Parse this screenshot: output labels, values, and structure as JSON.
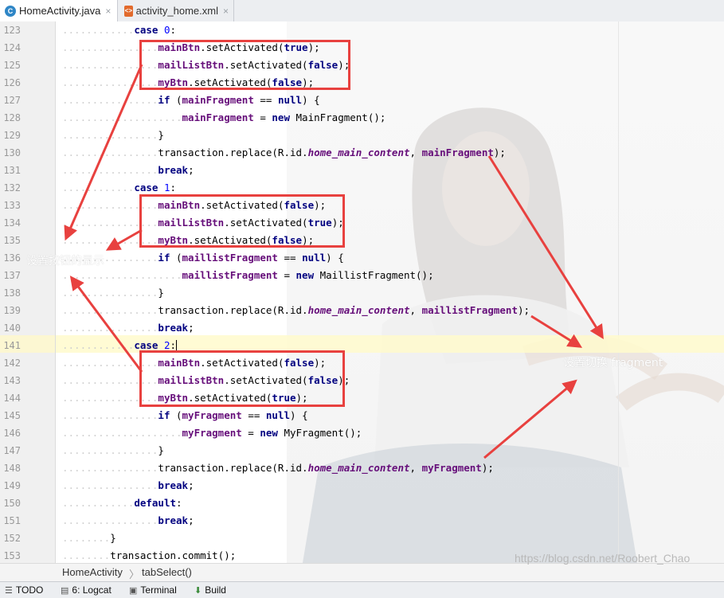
{
  "tabs": [
    {
      "label": "HomeActivity.java",
      "icon": "java-class-icon",
      "active": true
    },
    {
      "label": "activity_home.xml",
      "icon": "xml-file-icon",
      "active": false
    }
  ],
  "close_glyph": "×",
  "annotations": {
    "button_display": "设置按钮的显示",
    "fragment_switch": "设置切换 fragment"
  },
  "breadcrumb": [
    "HomeActivity",
    "tabSelect()"
  ],
  "breadcrumb_sep": "〉",
  "status_bar": [
    {
      "label": "TODO",
      "icon": "todo-icon"
    },
    {
      "label": "6: Logcat",
      "icon": "logcat-icon"
    },
    {
      "label": "Terminal",
      "icon": "terminal-icon"
    },
    {
      "label": "Build",
      "icon": "build-icon"
    }
  ],
  "watermark": "https://blog.csdn.net/Roobert_Chao",
  "colors": {
    "highlight_box": "#e8413f",
    "keyword": "#000080",
    "field": "#660e7a",
    "number": "#0000ff"
  },
  "code_lines": [
    {
      "n": "123",
      "indent": 3,
      "tokens": [
        [
          "kw",
          "case "
        ],
        [
          "num",
          "0"
        ],
        [
          "p",
          ":"
        ]
      ]
    },
    {
      "n": "124",
      "indent": 4,
      "tokens": [
        [
          "fld",
          "mainBtn"
        ],
        [
          "p",
          ".setActivated("
        ],
        [
          "kw",
          "true"
        ],
        [
          "p",
          ");"
        ]
      ]
    },
    {
      "n": "125",
      "indent": 4,
      "tokens": [
        [
          "fld",
          "mailListBtn"
        ],
        [
          "p",
          ".setActivated("
        ],
        [
          "kw",
          "false"
        ],
        [
          "p",
          ");"
        ]
      ]
    },
    {
      "n": "126",
      "indent": 4,
      "tokens": [
        [
          "fld",
          "myBtn"
        ],
        [
          "p",
          ".setActivated("
        ],
        [
          "kw",
          "false"
        ],
        [
          "p",
          ");"
        ]
      ]
    },
    {
      "n": "127",
      "indent": 4,
      "tokens": [
        [
          "kw",
          "if "
        ],
        [
          "p",
          "("
        ],
        [
          "fld",
          "mainFragment"
        ],
        [
          "p",
          " == "
        ],
        [
          "kw",
          "null"
        ],
        [
          "p",
          ") {"
        ]
      ]
    },
    {
      "n": "128",
      "indent": 5,
      "tokens": [
        [
          "fld",
          "mainFragment"
        ],
        [
          "p",
          " = "
        ],
        [
          "kw",
          "new "
        ],
        [
          "p",
          "MainFragment();"
        ]
      ]
    },
    {
      "n": "129",
      "indent": 4,
      "tokens": [
        [
          "p",
          "}"
        ]
      ]
    },
    {
      "n": "130",
      "indent": 4,
      "tokens": [
        [
          "p",
          "transaction.replace(R.id."
        ],
        [
          "sfld",
          "home_main_content"
        ],
        [
          "p",
          ", "
        ],
        [
          "fld",
          "mainFragment"
        ],
        [
          "p",
          ");"
        ]
      ]
    },
    {
      "n": "131",
      "indent": 4,
      "tokens": [
        [
          "kw",
          "break"
        ],
        [
          "p",
          ";"
        ]
      ]
    },
    {
      "n": "132",
      "indent": 3,
      "tokens": [
        [
          "kw",
          "case "
        ],
        [
          "num",
          "1"
        ],
        [
          "p",
          ":"
        ]
      ]
    },
    {
      "n": "133",
      "indent": 4,
      "tokens": [
        [
          "fld",
          "mainBtn"
        ],
        [
          "p",
          ".setActivated("
        ],
        [
          "kw",
          "false"
        ],
        [
          "p",
          ");"
        ]
      ]
    },
    {
      "n": "134",
      "indent": 4,
      "tokens": [
        [
          "fld",
          "mailListBtn"
        ],
        [
          "p",
          ".setActivated("
        ],
        [
          "kw",
          "true"
        ],
        [
          "p",
          ");"
        ]
      ]
    },
    {
      "n": "135",
      "indent": 4,
      "tokens": [
        [
          "fld",
          "myBtn"
        ],
        [
          "p",
          ".setActivated("
        ],
        [
          "kw",
          "false"
        ],
        [
          "p",
          ");"
        ]
      ]
    },
    {
      "n": "136",
      "indent": 4,
      "tokens": [
        [
          "kw",
          "if "
        ],
        [
          "p",
          "("
        ],
        [
          "fld",
          "maillistFragment"
        ],
        [
          "p",
          " == "
        ],
        [
          "kw",
          "null"
        ],
        [
          "p",
          ") {"
        ]
      ]
    },
    {
      "n": "137",
      "indent": 5,
      "tokens": [
        [
          "fld",
          "maillistFragment"
        ],
        [
          "p",
          " = "
        ],
        [
          "kw",
          "new "
        ],
        [
          "p",
          "MaillistFragment();"
        ]
      ]
    },
    {
      "n": "138",
      "indent": 4,
      "tokens": [
        [
          "p",
          "}"
        ]
      ]
    },
    {
      "n": "139",
      "indent": 4,
      "tokens": [
        [
          "p",
          "transaction.replace(R.id."
        ],
        [
          "sfld",
          "home_main_content"
        ],
        [
          "p",
          ", "
        ],
        [
          "fld",
          "maillistFragment"
        ],
        [
          "p",
          ");"
        ]
      ]
    },
    {
      "n": "140",
      "indent": 4,
      "tokens": [
        [
          "kw",
          "break"
        ],
        [
          "p",
          ";"
        ]
      ]
    },
    {
      "n": "141",
      "indent": 3,
      "tokens": [
        [
          "kw",
          "case "
        ],
        [
          "num",
          "2"
        ],
        [
          "p",
          ":"
        ],
        [
          "caret",
          ""
        ]
      ]
    },
    {
      "n": "142",
      "indent": 4,
      "tokens": [
        [
          "fld",
          "mainBtn"
        ],
        [
          "p",
          ".setActivated("
        ],
        [
          "kw",
          "false"
        ],
        [
          "p",
          ");"
        ]
      ]
    },
    {
      "n": "143",
      "indent": 4,
      "tokens": [
        [
          "fld",
          "mailListBtn"
        ],
        [
          "p",
          ".setActivated("
        ],
        [
          "kw",
          "false"
        ],
        [
          "p",
          ");"
        ]
      ]
    },
    {
      "n": "144",
      "indent": 4,
      "tokens": [
        [
          "fld",
          "myBtn"
        ],
        [
          "p",
          ".setActivated("
        ],
        [
          "kw",
          "true"
        ],
        [
          "p",
          ");"
        ]
      ]
    },
    {
      "n": "145",
      "indent": 4,
      "tokens": [
        [
          "kw",
          "if "
        ],
        [
          "p",
          "("
        ],
        [
          "fld",
          "myFragment"
        ],
        [
          "p",
          " == "
        ],
        [
          "kw",
          "null"
        ],
        [
          "p",
          ") {"
        ]
      ]
    },
    {
      "n": "146",
      "indent": 5,
      "tokens": [
        [
          "fld",
          "myFragment"
        ],
        [
          "p",
          " = "
        ],
        [
          "kw",
          "new "
        ],
        [
          "p",
          "MyFragment();"
        ]
      ]
    },
    {
      "n": "147",
      "indent": 4,
      "tokens": [
        [
          "p",
          "}"
        ]
      ]
    },
    {
      "n": "148",
      "indent": 4,
      "tokens": [
        [
          "p",
          "transaction.replace(R.id."
        ],
        [
          "sfld",
          "home_main_content"
        ],
        [
          "p",
          ", "
        ],
        [
          "fld",
          "myFragment"
        ],
        [
          "p",
          ");"
        ]
      ]
    },
    {
      "n": "149",
      "indent": 4,
      "tokens": [
        [
          "kw",
          "break"
        ],
        [
          "p",
          ";"
        ]
      ]
    },
    {
      "n": "150",
      "indent": 3,
      "tokens": [
        [
          "kw",
          "default"
        ],
        [
          "p",
          ":"
        ]
      ]
    },
    {
      "n": "151",
      "indent": 4,
      "tokens": [
        [
          "kw",
          "break"
        ],
        [
          "p",
          ";"
        ]
      ]
    },
    {
      "n": "152",
      "indent": 2,
      "tokens": [
        [
          "p",
          "}"
        ]
      ]
    },
    {
      "n": "153",
      "indent": 2,
      "tokens": [
        [
          "p",
          "transaction.commit();"
        ]
      ]
    }
  ]
}
